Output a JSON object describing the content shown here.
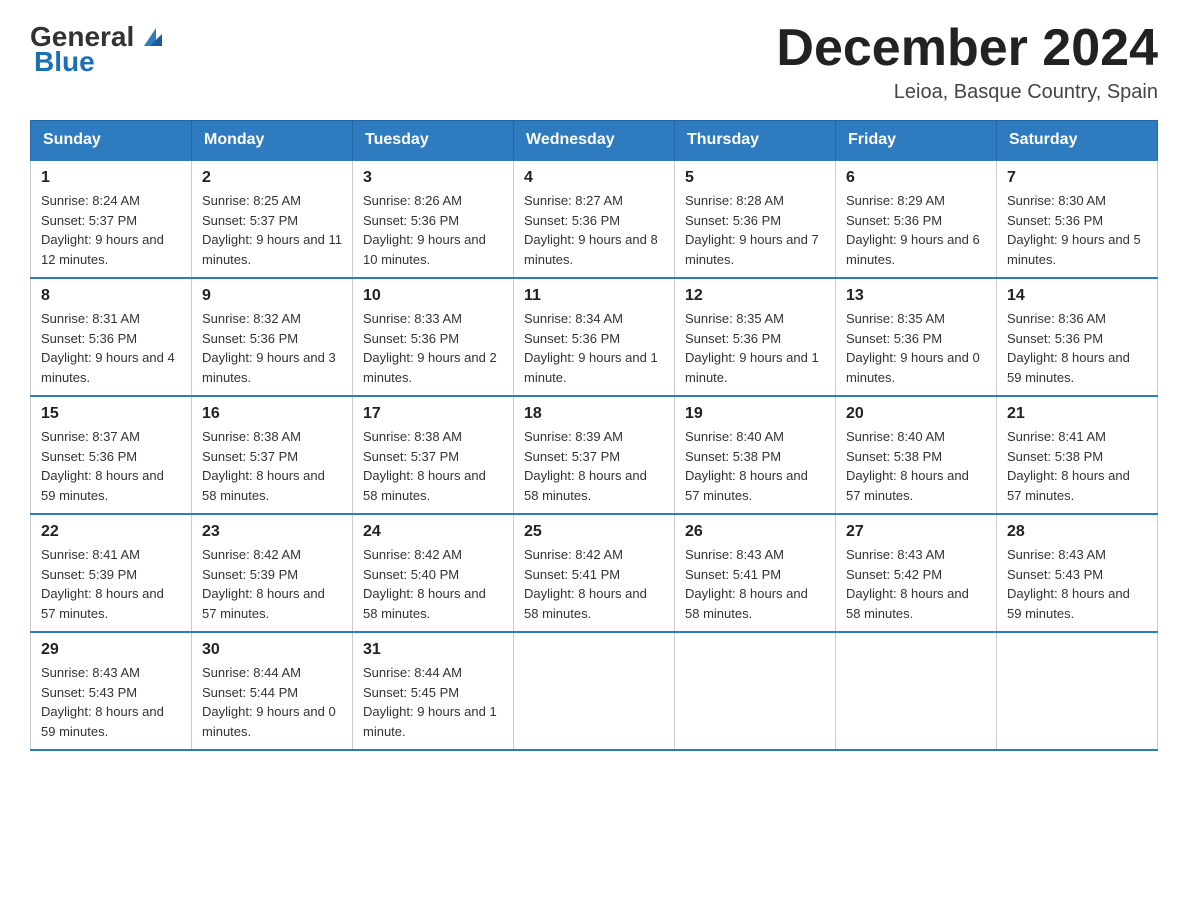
{
  "header": {
    "logo_general": "General",
    "logo_blue": "Blue",
    "month_title": "December 2024",
    "location": "Leioa, Basque Country, Spain"
  },
  "days_of_week": [
    "Sunday",
    "Monday",
    "Tuesday",
    "Wednesday",
    "Thursday",
    "Friday",
    "Saturday"
  ],
  "weeks": [
    [
      {
        "day": "1",
        "sunrise": "8:24 AM",
        "sunset": "5:37 PM",
        "daylight": "9 hours and 12 minutes."
      },
      {
        "day": "2",
        "sunrise": "8:25 AM",
        "sunset": "5:37 PM",
        "daylight": "9 hours and 11 minutes."
      },
      {
        "day": "3",
        "sunrise": "8:26 AM",
        "sunset": "5:36 PM",
        "daylight": "9 hours and 10 minutes."
      },
      {
        "day": "4",
        "sunrise": "8:27 AM",
        "sunset": "5:36 PM",
        "daylight": "9 hours and 8 minutes."
      },
      {
        "day": "5",
        "sunrise": "8:28 AM",
        "sunset": "5:36 PM",
        "daylight": "9 hours and 7 minutes."
      },
      {
        "day": "6",
        "sunrise": "8:29 AM",
        "sunset": "5:36 PM",
        "daylight": "9 hours and 6 minutes."
      },
      {
        "day": "7",
        "sunrise": "8:30 AM",
        "sunset": "5:36 PM",
        "daylight": "9 hours and 5 minutes."
      }
    ],
    [
      {
        "day": "8",
        "sunrise": "8:31 AM",
        "sunset": "5:36 PM",
        "daylight": "9 hours and 4 minutes."
      },
      {
        "day": "9",
        "sunrise": "8:32 AM",
        "sunset": "5:36 PM",
        "daylight": "9 hours and 3 minutes."
      },
      {
        "day": "10",
        "sunrise": "8:33 AM",
        "sunset": "5:36 PM",
        "daylight": "9 hours and 2 minutes."
      },
      {
        "day": "11",
        "sunrise": "8:34 AM",
        "sunset": "5:36 PM",
        "daylight": "9 hours and 1 minute."
      },
      {
        "day": "12",
        "sunrise": "8:35 AM",
        "sunset": "5:36 PM",
        "daylight": "9 hours and 1 minute."
      },
      {
        "day": "13",
        "sunrise": "8:35 AM",
        "sunset": "5:36 PM",
        "daylight": "9 hours and 0 minutes."
      },
      {
        "day": "14",
        "sunrise": "8:36 AM",
        "sunset": "5:36 PM",
        "daylight": "8 hours and 59 minutes."
      }
    ],
    [
      {
        "day": "15",
        "sunrise": "8:37 AM",
        "sunset": "5:36 PM",
        "daylight": "8 hours and 59 minutes."
      },
      {
        "day": "16",
        "sunrise": "8:38 AM",
        "sunset": "5:37 PM",
        "daylight": "8 hours and 58 minutes."
      },
      {
        "day": "17",
        "sunrise": "8:38 AM",
        "sunset": "5:37 PM",
        "daylight": "8 hours and 58 minutes."
      },
      {
        "day": "18",
        "sunrise": "8:39 AM",
        "sunset": "5:37 PM",
        "daylight": "8 hours and 58 minutes."
      },
      {
        "day": "19",
        "sunrise": "8:40 AM",
        "sunset": "5:38 PM",
        "daylight": "8 hours and 57 minutes."
      },
      {
        "day": "20",
        "sunrise": "8:40 AM",
        "sunset": "5:38 PM",
        "daylight": "8 hours and 57 minutes."
      },
      {
        "day": "21",
        "sunrise": "8:41 AM",
        "sunset": "5:38 PM",
        "daylight": "8 hours and 57 minutes."
      }
    ],
    [
      {
        "day": "22",
        "sunrise": "8:41 AM",
        "sunset": "5:39 PM",
        "daylight": "8 hours and 57 minutes."
      },
      {
        "day": "23",
        "sunrise": "8:42 AM",
        "sunset": "5:39 PM",
        "daylight": "8 hours and 57 minutes."
      },
      {
        "day": "24",
        "sunrise": "8:42 AM",
        "sunset": "5:40 PM",
        "daylight": "8 hours and 58 minutes."
      },
      {
        "day": "25",
        "sunrise": "8:42 AM",
        "sunset": "5:41 PM",
        "daylight": "8 hours and 58 minutes."
      },
      {
        "day": "26",
        "sunrise": "8:43 AM",
        "sunset": "5:41 PM",
        "daylight": "8 hours and 58 minutes."
      },
      {
        "day": "27",
        "sunrise": "8:43 AM",
        "sunset": "5:42 PM",
        "daylight": "8 hours and 58 minutes."
      },
      {
        "day": "28",
        "sunrise": "8:43 AM",
        "sunset": "5:43 PM",
        "daylight": "8 hours and 59 minutes."
      }
    ],
    [
      {
        "day": "29",
        "sunrise": "8:43 AM",
        "sunset": "5:43 PM",
        "daylight": "8 hours and 59 minutes."
      },
      {
        "day": "30",
        "sunrise": "8:44 AM",
        "sunset": "5:44 PM",
        "daylight": "9 hours and 0 minutes."
      },
      {
        "day": "31",
        "sunrise": "8:44 AM",
        "sunset": "5:45 PM",
        "daylight": "9 hours and 1 minute."
      },
      null,
      null,
      null,
      null
    ]
  ],
  "labels": {
    "sunrise": "Sunrise:",
    "sunset": "Sunset:",
    "daylight": "Daylight:"
  }
}
